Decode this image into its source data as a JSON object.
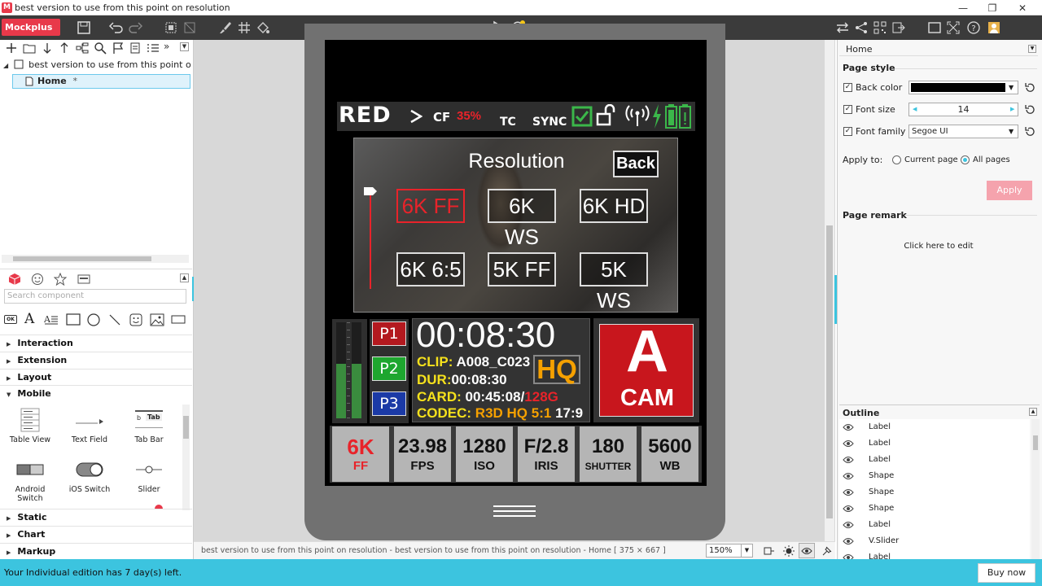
{
  "window": {
    "title": "best version to use from this point on resolution",
    "app_icon": "M"
  },
  "toolbar": {
    "app_label": "Mockplus",
    "accent": "#e8394a"
  },
  "left_panel": {
    "tree_root": "best version to use from this point on resoluti",
    "tree_home": "Home",
    "tree_home_marker": "*",
    "search_placeholder": "Search component",
    "categories": [
      "Interaction",
      "Extension",
      "Layout",
      "Mobile",
      "Static",
      "Chart",
      "Markup"
    ],
    "components": [
      {
        "label": "Table View"
      },
      {
        "label": "Text Field"
      },
      {
        "label": "Tab Bar"
      },
      {
        "label": "Android Switch"
      },
      {
        "label": "iOS Switch"
      },
      {
        "label": "Slider"
      }
    ],
    "tabbar_glyphs": {
      "b": "b",
      "tab": "Tab"
    },
    "widget_glyphs": {
      "ok": "OK",
      "text": "A"
    }
  },
  "canvas": {
    "status_text": "best version to use from this point on resolution - best version to use from this point on resolution - Home [ 375 × 667 ]",
    "zoom": "150%"
  },
  "camera": {
    "brand": "RED",
    "cf_label": "CF",
    "cf_value": "35%",
    "tc_label": "TC",
    "sync_label": "SYNC",
    "res_title": "Resolution",
    "back_label": "Back",
    "res_options": [
      "6K FF",
      "6K WS",
      "6K HD",
      "6K 6:5",
      "5K FF",
      "5K WS"
    ],
    "selected_option": "6K FF",
    "presets": [
      "P1",
      "P2",
      "P3"
    ],
    "timecode": "00:08:30",
    "clip_label": "CLIP:",
    "clip_value": "A008_C023",
    "quality": "HQ",
    "dur_label": "DUR:",
    "dur_value": "00:08:30",
    "card_label": "CARD:",
    "card_used": "00:45:08/",
    "card_total": "128G",
    "codec_label": "CODEC:",
    "codec_value": "R3D HQ 5:1",
    "codec_ratio": "17:9",
    "cam_letter": "A",
    "cam_word": "CAM",
    "audio_left_level": 0.57,
    "audio_right_level": 0.57,
    "tiles": [
      {
        "value": "6K",
        "unit": "FF"
      },
      {
        "value": "23.98",
        "unit": "FPS"
      },
      {
        "value": "1280",
        "unit": "ISO"
      },
      {
        "value": "F/2.8",
        "unit": "IRIS"
      },
      {
        "value": "180",
        "unit": "SHUTTER"
      },
      {
        "value": "5600",
        "unit": "WB"
      }
    ]
  },
  "right_panel": {
    "page_select": "Home",
    "page_style": "Page style",
    "back_color_label": "Back color",
    "back_color_value": "#000000",
    "font_size_label": "Font size",
    "font_size_value": "14",
    "font_family_label": "Font family",
    "font_family_value": "Segoe UI",
    "apply_to_label": "Apply to:",
    "current_page": "Current page",
    "all_pages": "All pages",
    "apply_button": "Apply",
    "page_remark": "Page remark",
    "click_to_edit": "Click here to edit",
    "outline_title": "Outline",
    "outline_items": [
      "Label",
      "Label",
      "Label",
      "Shape",
      "Shape",
      "Shape",
      "Label",
      "V.Slider",
      "Label"
    ]
  },
  "notification": {
    "text": "Your Individual edition has 7 day(s) left.",
    "buy_label": "Buy now"
  }
}
